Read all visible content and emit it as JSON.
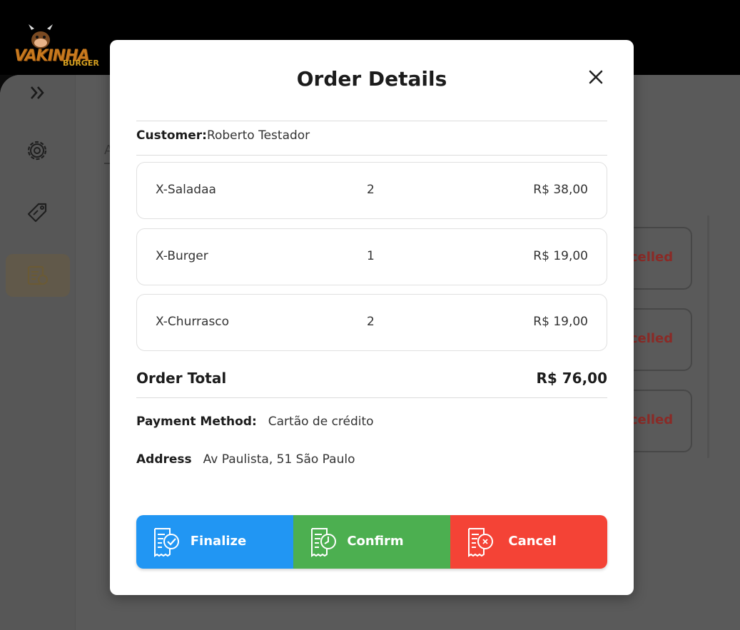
{
  "app": {
    "logo_text": "VAKINHA",
    "logo_subtext": "BURGER",
    "background_tab_text": "A",
    "background_card_status": "ncelled"
  },
  "modal": {
    "title": "Order Details",
    "customer_label": "Customer:",
    "customer_name": "Roberto Testador",
    "items": [
      {
        "name": "X-Saladaa",
        "qty": "2",
        "price": "R$ 38,00"
      },
      {
        "name": "X-Burger",
        "qty": "1",
        "price": "R$ 19,00"
      },
      {
        "name": "X-Churrasco",
        "qty": "2",
        "price": "R$ 19,00"
      }
    ],
    "total_label": "Order Total",
    "total_value": "R$ 76,00",
    "payment_label": "Payment Method:",
    "payment_value": "Cartão de crédito",
    "address_label": "Address",
    "address_value": "Av Paulista, 51 São Paulo",
    "buttons": {
      "finalize": "Finalize",
      "confirm": "Confirm",
      "cancel": "Cancel"
    }
  },
  "colors": {
    "finalize": "#2196f3",
    "confirm": "#4caf50",
    "cancel": "#f44336",
    "cancel_status_text": "#8a2a26"
  },
  "icons": {
    "close": "close-icon",
    "finalize": "order-check-icon",
    "confirm": "order-clock-icon",
    "cancel": "order-x-icon"
  }
}
